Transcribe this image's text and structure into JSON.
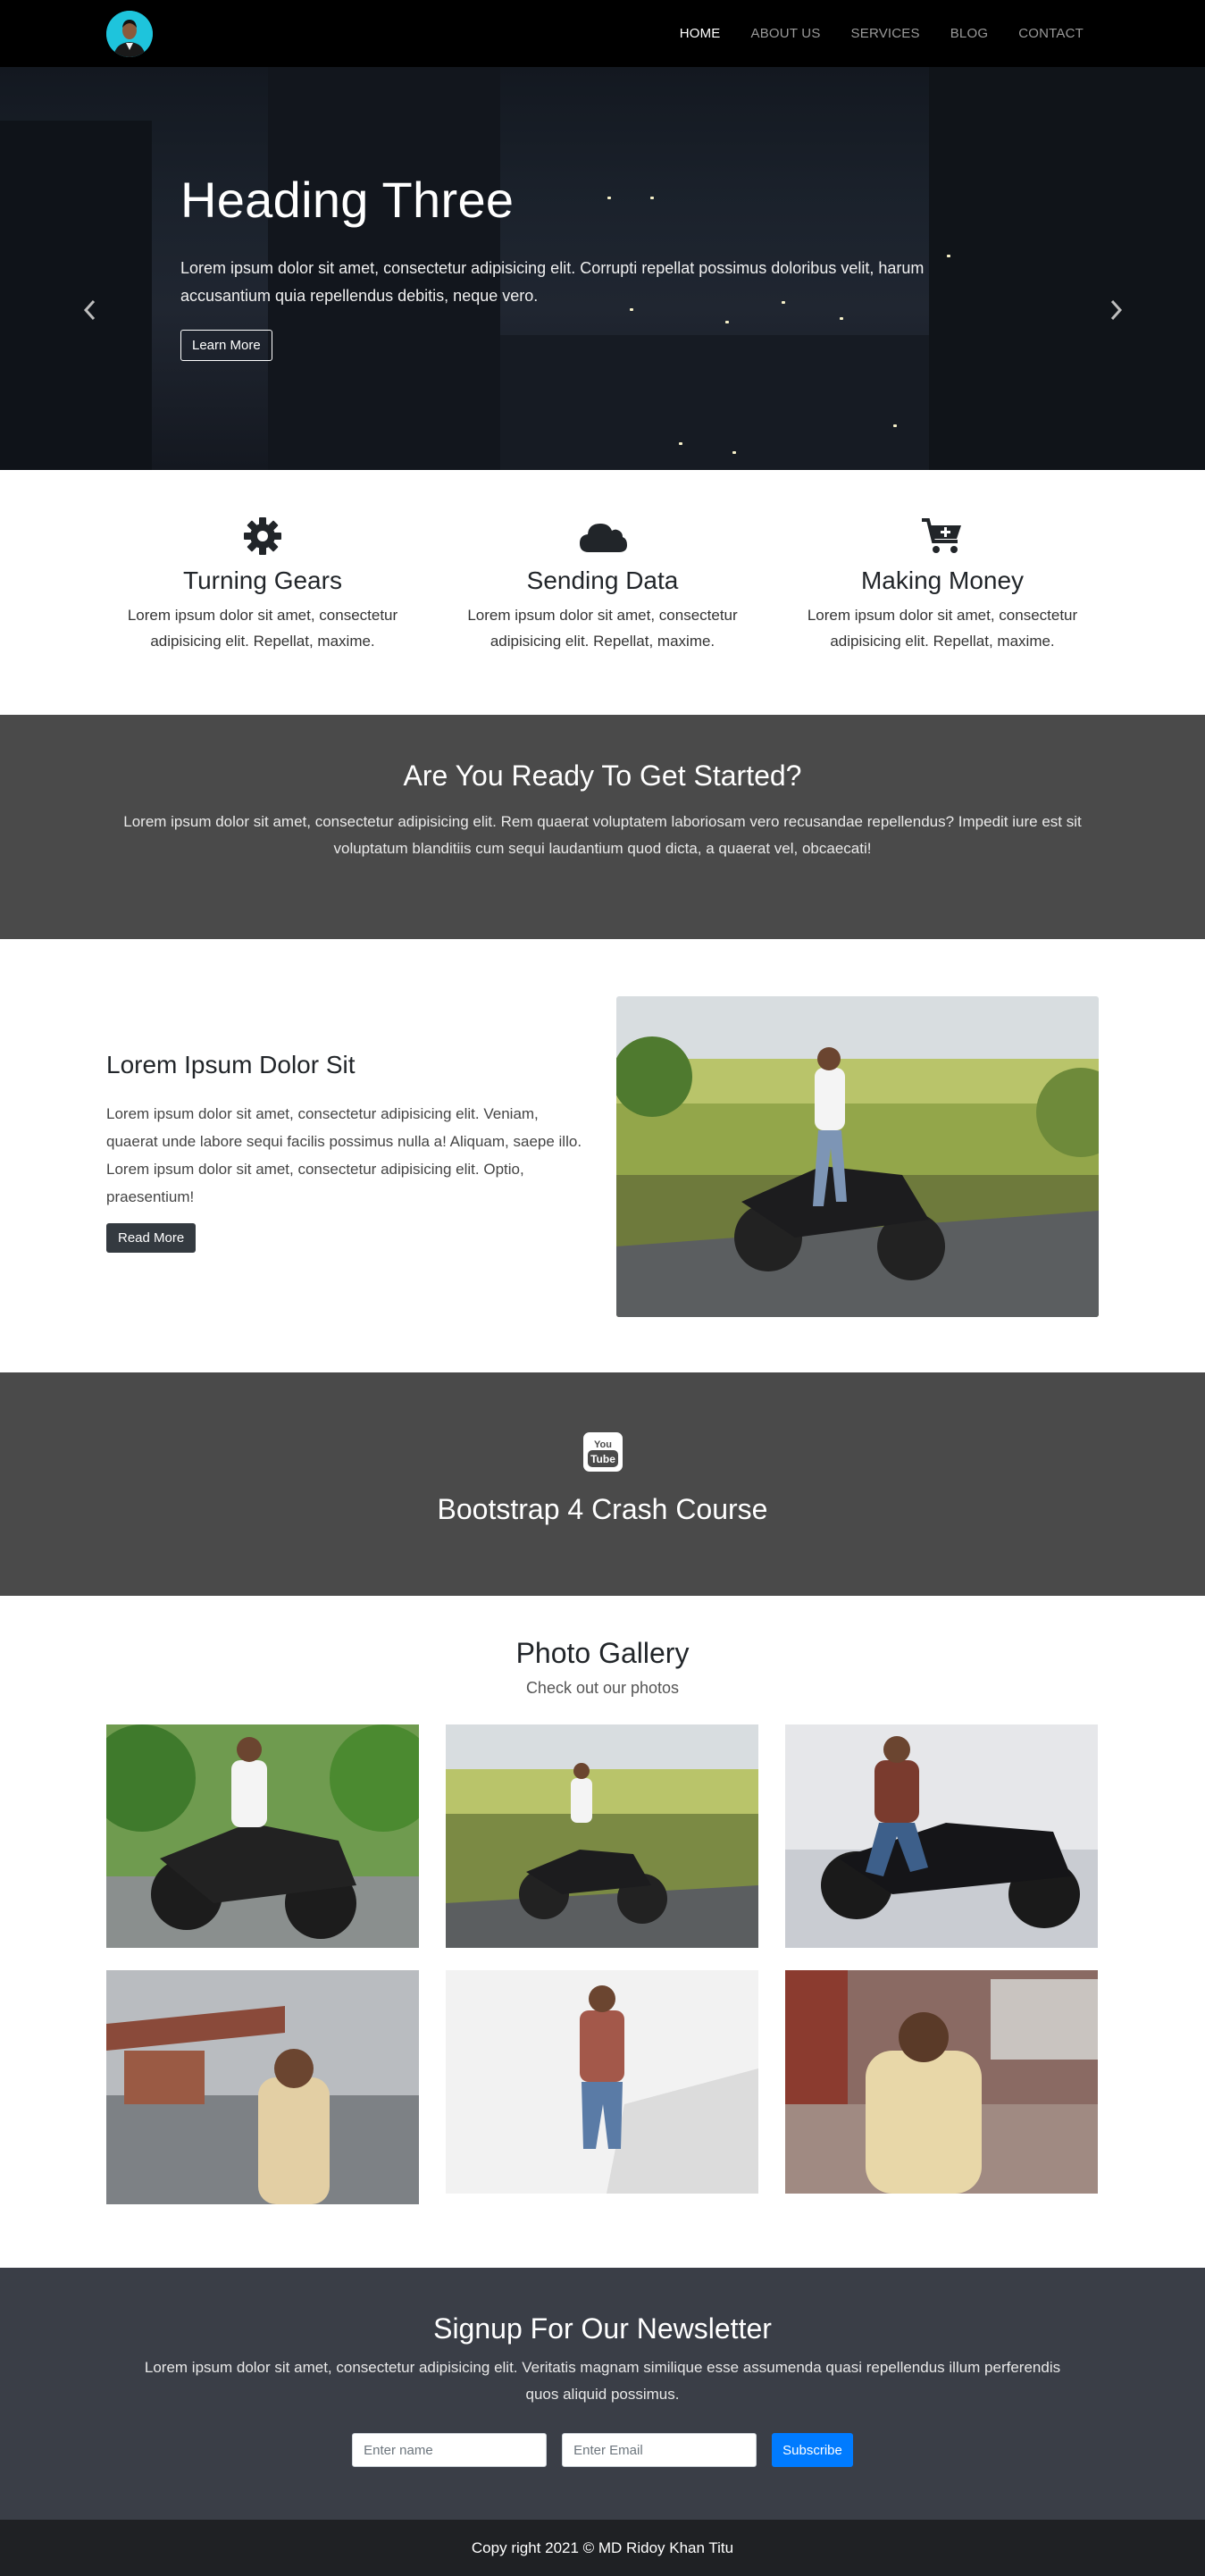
{
  "nav": {
    "brand_icon": "avatar-logo",
    "links": [
      {
        "label": "HOME",
        "active": true
      },
      {
        "label": "ABOUT US",
        "active": false
      },
      {
        "label": "SERVICES",
        "active": false
      },
      {
        "label": "BLOG",
        "active": false
      },
      {
        "label": "CONTACT",
        "active": false
      }
    ]
  },
  "hero": {
    "title": "Heading Three",
    "text": "Lorem ipsum dolor sit amet, consectetur adipisicing elit. Corrupti repellat possimus doloribus velit, harum accusantium quia repellendus debitis, neque vero.",
    "button": "Learn More",
    "prev_icon": "chevron-left-icon",
    "next_icon": "chevron-right-icon",
    "slide_count": 3,
    "active_slide": 3
  },
  "features": [
    {
      "icon": "gear-icon",
      "title": "Turning Gears",
      "text": "Lorem ipsum dolor sit amet, consectetur adipisicing elit. Repellat, maxime."
    },
    {
      "icon": "cloud-icon",
      "title": "Sending Data",
      "text": "Lorem ipsum dolor sit amet, consectetur adipisicing elit. Repellat, maxime."
    },
    {
      "icon": "cart-plus-icon",
      "title": "Making Money",
      "text": "Lorem ipsum dolor sit amet, consectetur adipisicing elit. Repellat, maxime."
    }
  ],
  "ready": {
    "title": "Are You Ready To Get Started?",
    "text": "Lorem ipsum dolor sit amet, consectetur adipisicing elit. Rem quaerat voluptatem laboriosam vero recusandae repellendus? Impedit iure est sit voluptatum blanditiis cum sequi laudantium quod dicta, a quaerat vel, obcaecati!"
  },
  "about": {
    "title": "Lorem Ipsum Dolor Sit",
    "text": "Lorem ipsum dolor sit amet, consectetur adipisicing elit. Veniam, quaerat unde labore sequi facilis possimus nulla a! Aliquam, saepe illo. Lorem ipsum dolor sit amet, consectetur adipisicing elit. Optio, praesentium!",
    "button": "Read More"
  },
  "video": {
    "icon": "youtube-icon",
    "title": "Bootstrap 4 Crash Course"
  },
  "gallery": {
    "title": "Photo Gallery",
    "subtitle": "Check out our photos"
  },
  "newsletter": {
    "title": "Signup For Our Newsletter",
    "text": "Lorem ipsum dolor sit amet, consectetur adipisicing elit. Veritatis magnam similique esse assumenda quasi repellendus illum perferendis quos aliquid possimus.",
    "name_placeholder": "Enter name",
    "email_placeholder": "Enter Email",
    "button": "Subscribe"
  },
  "footer": {
    "text": "Copy right 2021 © MD Ridoy Khan Titu"
  },
  "colors": {
    "accent": "#007bff",
    "dark_section": "#4a4a4a",
    "newsletter_bg": "#3a3e47",
    "footer_bg": "#1f2124",
    "brand_bg": "#1ec4dc"
  }
}
